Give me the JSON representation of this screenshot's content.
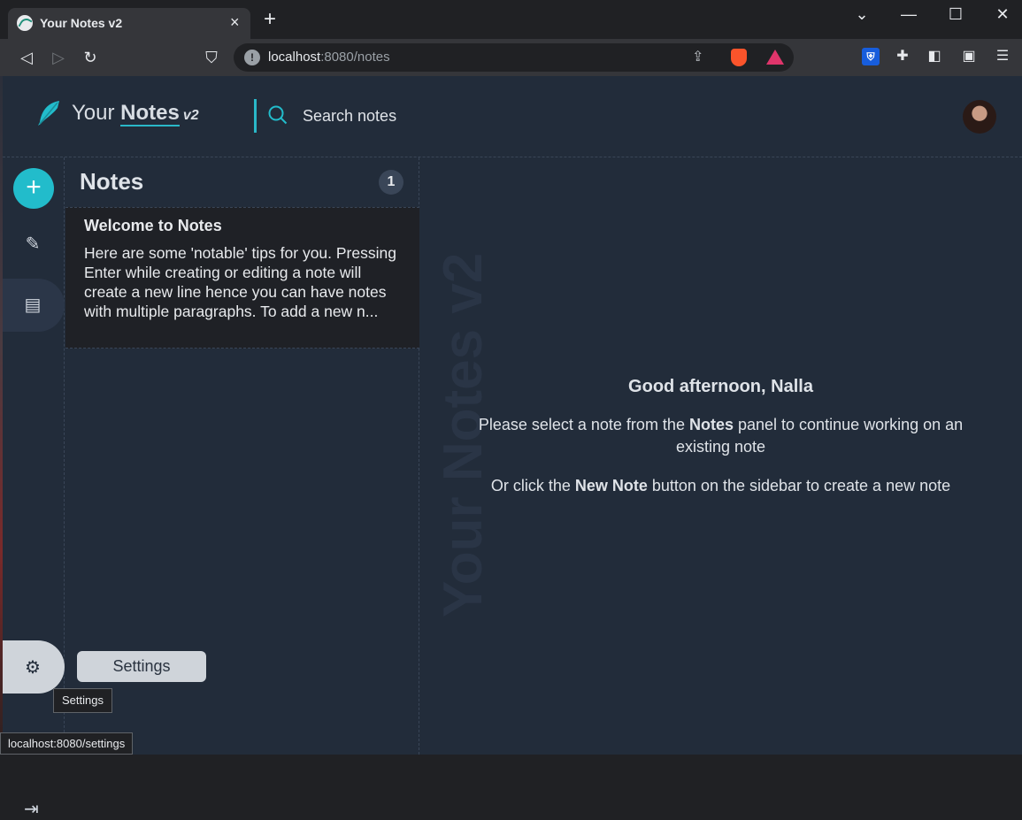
{
  "browser": {
    "tab_title": "Your Notes v2",
    "tab_close": "×",
    "new_tab": "+",
    "url_host": "localhost",
    "url_path": ":8080/notes",
    "window_controls": [
      "⌄",
      "—",
      "☐",
      "✕"
    ]
  },
  "header": {
    "logo_your": "Your",
    "logo_notes": "Notes",
    "logo_version": "v2",
    "search_label": "Search notes"
  },
  "sidebar": {
    "new_note_symbol": "+",
    "settings_label": "Settings",
    "settings_tooltip": "Settings"
  },
  "notes_panel": {
    "title": "Notes",
    "count": "1",
    "notes": [
      {
        "title": "Welcome to Notes",
        "preview": "Here are some 'notable' tips for you. Pressing Enter while creating or editing a note will create a new line hence you can have notes with multiple paragraphs. To add a new n..."
      }
    ]
  },
  "main": {
    "greeting": "Good afternoon, Nalla",
    "select_prefix": "Please select a note from the ",
    "select_bold": "Notes",
    "select_suffix": " panel to continue working on an existing note",
    "create_prefix": "Or click the ",
    "create_bold": "New Note",
    "create_suffix": " button on the sidebar to create a new note",
    "watermark_text": "Your Notes v2"
  },
  "status_bar": {
    "url": "localhost:8080/settings"
  },
  "colors": {
    "accent": "#22bccb",
    "app_background": "#222c3a",
    "note_card_background": "#1f2126"
  }
}
